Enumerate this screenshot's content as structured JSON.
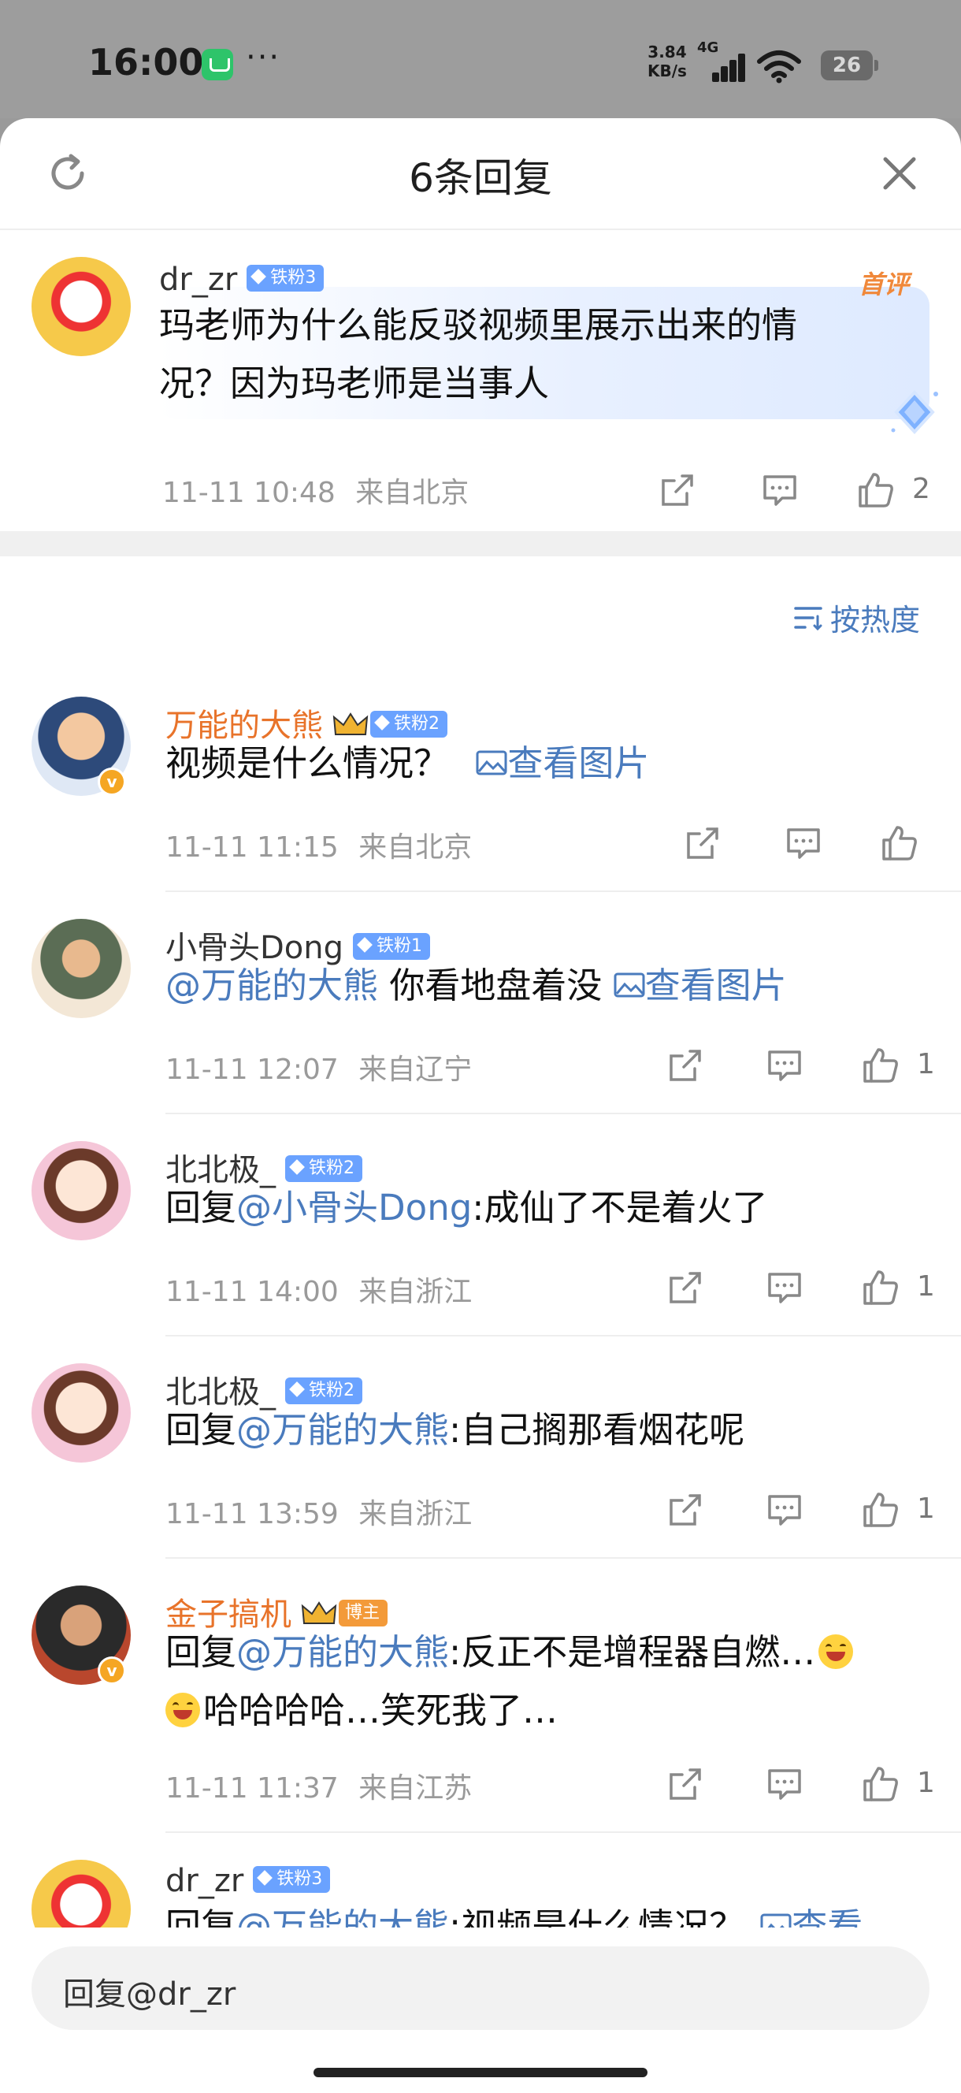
{
  "status_bar": {
    "time": "16:00",
    "dots": "···",
    "net_speed_value": "3.84",
    "net_speed_unit": "KB/s",
    "network": "4G",
    "battery": "26"
  },
  "sheet": {
    "title": "6条回复"
  },
  "root_comment": {
    "user": "dr_zr",
    "badge": "铁粉3",
    "first_label": "首评",
    "text_line1": "玛老师为什么能反驳视频里展示出来的情",
    "text_line2": "况？因为玛老师是当事人",
    "time": "11-11 10:48",
    "location": "来自北京",
    "likes": "2"
  },
  "sort": {
    "label": "按热度"
  },
  "replies": [
    {
      "user": "万能的大熊",
      "badge": "铁粉2",
      "text": "视频是什么情况？",
      "image_link": "查看图片",
      "time": "11-11 11:15",
      "location": "来自北京",
      "likes": ""
    },
    {
      "user": "小骨头Dong",
      "badge": "铁粉1",
      "mention": "@万能的大熊",
      "text": " 你看地盘着没 ",
      "image_link": "查看图片",
      "time": "11-11 12:07",
      "location": "来自辽宁",
      "likes": "1"
    },
    {
      "user": "北北极_",
      "badge": "铁粉2",
      "prefix": "回复",
      "mention": "@小骨头Dong",
      "text": ":成仙了不是着火了",
      "time": "11-11 14:00",
      "location": "来自浙江",
      "likes": "1"
    },
    {
      "user": "北北极_",
      "badge": "铁粉2",
      "prefix": "回复",
      "mention": "@万能的大熊",
      "text": ":自己搁那看烟花呢",
      "time": "11-11 13:59",
      "location": "来自浙江",
      "likes": "1"
    },
    {
      "user": "金子搞机",
      "badge": "博主",
      "prefix": "回复",
      "mention": "@万能的大熊",
      "text": ":反正不是增程器自燃…",
      "text_line2": "哈哈哈哈…笑死我了…",
      "time": "11-11 11:37",
      "location": "来自江苏",
      "likes": "1"
    },
    {
      "user": "dr_zr",
      "badge": "铁粉3",
      "prefix": "回复",
      "mention": "@万能的大熊",
      "text": ":视频是什么情况？",
      "image_link": "查看"
    }
  ],
  "input": {
    "placeholder": "回复@dr_zr"
  },
  "colors": {
    "link": "#4a7bbd",
    "orange_name": "#e8732a",
    "fan_badge": "#6aa2ff",
    "meta": "#9a9a9a"
  }
}
